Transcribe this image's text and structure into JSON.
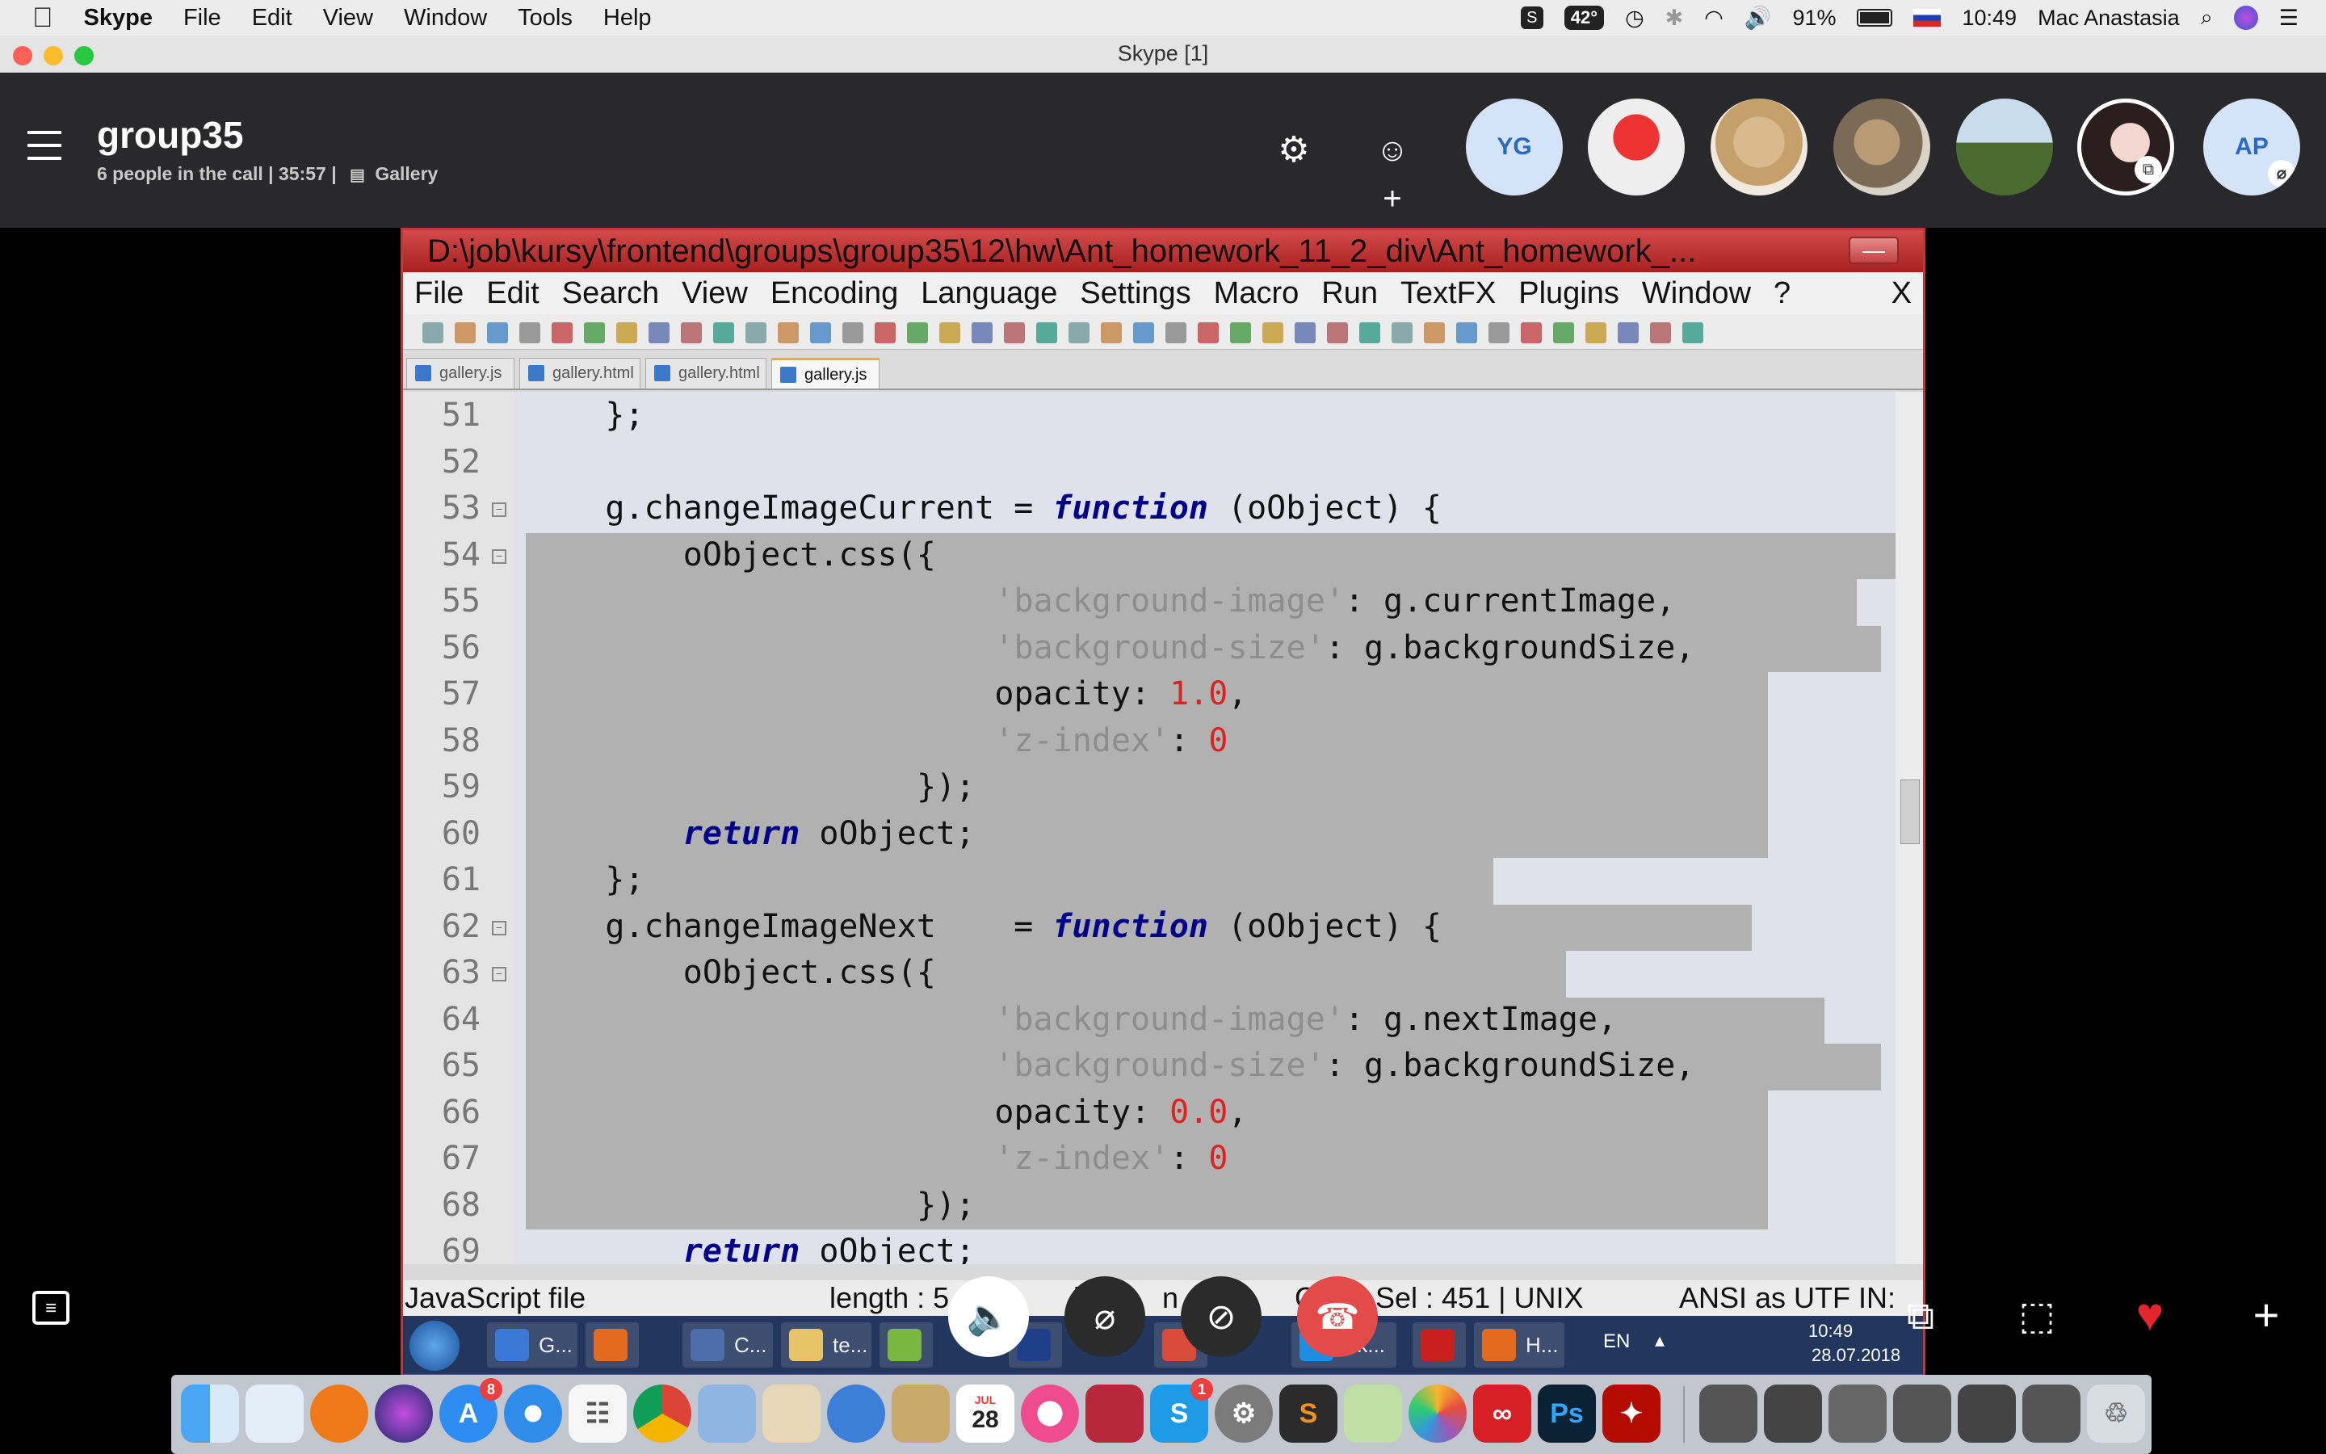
{
  "menubar": {
    "app": "Skype",
    "items": [
      "File",
      "Edit",
      "View",
      "Window",
      "Tools",
      "Help"
    ],
    "temperature": "42°",
    "battery": "91%",
    "time": "10:49",
    "user": "Mac Anastasia"
  },
  "window": {
    "title": "Skype [1]"
  },
  "call": {
    "group": "group35",
    "info": "6 people in the call | 35:57  |",
    "gallery": "Gallery",
    "participants": [
      {
        "initials": "YG"
      },
      {
        "initials": ""
      },
      {
        "initials": ""
      },
      {
        "initials": ""
      },
      {
        "initials": ""
      },
      {
        "initials": ""
      },
      {
        "initials": "AP"
      }
    ]
  },
  "npp": {
    "title": "D:\\job\\kursy\\frontend\\groups\\group35\\12\\hw\\Ant_homework_11_2_div\\Ant_homework_...",
    "menu": [
      "File",
      "Edit",
      "Search",
      "View",
      "Encoding",
      "Language",
      "Settings",
      "Macro",
      "Run",
      "TextFX",
      "Plugins",
      "Window",
      "?"
    ],
    "close_x": "X",
    "tabs": [
      "gallery.js",
      "gallery.html",
      "gallery.html",
      "gallery.js"
    ],
    "lines": [
      {
        "n": "51",
        "text": "};"
      },
      {
        "n": "52",
        "text": ""
      },
      {
        "n": "53",
        "text": "g.changeImageCurrent = function (oObject) {"
      },
      {
        "n": "54",
        "text": "oObject.css({"
      },
      {
        "n": "55",
        "text": "'background-image': g.currentImage,"
      },
      {
        "n": "56",
        "text": "'background-size': g.backgroundSize,"
      },
      {
        "n": "57",
        "text": "opacity: 1.0,"
      },
      {
        "n": "58",
        "text": "'z-index': 0"
      },
      {
        "n": "59",
        "text": "});"
      },
      {
        "n": "60",
        "text": "return oObject;"
      },
      {
        "n": "61",
        "text": "};"
      },
      {
        "n": "62",
        "text": "g.changeImageNext    = function (oObject) {"
      },
      {
        "n": "63",
        "text": "oObject.css({"
      },
      {
        "n": "64",
        "text": "'background-image': g.nextImage,"
      },
      {
        "n": "65",
        "text": "'background-size': g.backgroundSize,"
      },
      {
        "n": "66",
        "text": "opacity: 0.0,"
      },
      {
        "n": "67",
        "text": "'z-index': 0"
      },
      {
        "n": "68",
        "text": "});"
      },
      {
        "n": "69",
        "text": "return oObject;"
      }
    ],
    "status": {
      "file_type": "JavaScript file",
      "length": "length : 5",
      "ln": "lin",
      "n": "n :",
      "col": "Col",
      "sel": "Sel : 451 | UNIX",
      "encoding": "ANSI as UTF IN:"
    },
    "taskbar": {
      "items": [
        "G...",
        "C...",
        "te...",
        "Sk...",
        "H..."
      ],
      "lang": "EN",
      "time": "10:49",
      "date": "28.07.2018"
    }
  },
  "dock": {
    "calendar_month": "JUL",
    "calendar_day": "28",
    "appstore_badge": "8",
    "skype_badge": "1"
  }
}
